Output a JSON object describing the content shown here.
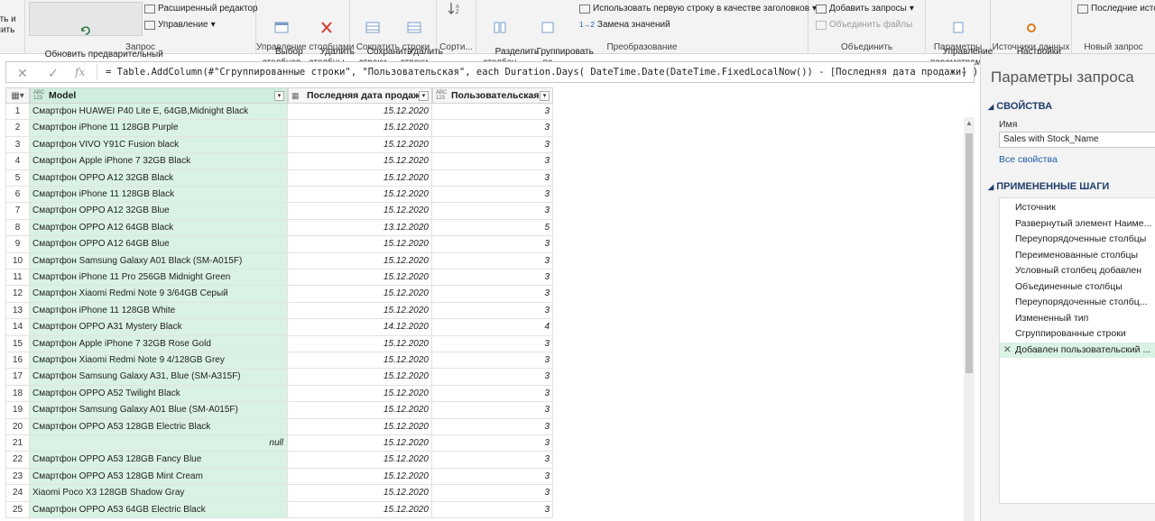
{
  "ribbon": {
    "cut_btn": "ить и\nнить",
    "group_query": {
      "refresh": "Обновить предварительный\nпросмотр",
      "advanced_editor": "Расширенный редактор",
      "manage": "Управление",
      "label": "Запрос"
    },
    "group_columns": {
      "choose": "Выбор\nстолбцов",
      "remove": "Удалить\nстолбцы",
      "label": "Управление столбцами"
    },
    "group_rows": {
      "keep": "Сохранить\nстроки",
      "remove": "Удалить\nстроки",
      "label": "Сократить строки"
    },
    "group_sort": {
      "label": "Сорти..."
    },
    "group_transform": {
      "split": "Разделить\nстолбец",
      "group_by": "Группировать\nпо",
      "use_first_row": "Использовать первую строку в качестве заголовков",
      "replace": "Замена значений",
      "label": "Преобразование"
    },
    "group_combine": {
      "append": "Добавить запросы",
      "merge_files": "Объединить файлы",
      "label": "Объединить"
    },
    "group_params": {
      "manage": "Управление\nпараметрами",
      "label": "Параметры"
    },
    "group_sources": {
      "settings": "Настройки\nисточника данных",
      "label": "Источники данных"
    },
    "group_new": {
      "recent": "Последние исто",
      "label": "Новый запрос"
    }
  },
  "formula_bar": {
    "formula": "= Table.AddColumn(#\"Сгруппированные строки\", \"Пользовательская\", each Duration.Days( DateTime.Date(DateTime.FixedLocalNow())  - [Последняя дата продажи] ))"
  },
  "table": {
    "columns": [
      {
        "type": "ABC\n123",
        "name": "Model"
      },
      {
        "type": "date",
        "name": "Последняя дата продажи"
      },
      {
        "type": "ABC\n123",
        "name": "Пользовательская"
      }
    ],
    "rows": [
      {
        "n": "1",
        "model": "Смартфон HUAWEI P40 Lite E, 64GB,Midnight Black",
        "date": "15.12.2020",
        "val": "3"
      },
      {
        "n": "2",
        "model": "Смартфон iPhone 11 128GB Purple",
        "date": "15.12.2020",
        "val": "3"
      },
      {
        "n": "3",
        "model": "Смартфон VIVO Y91C Fusion black",
        "date": "15.12.2020",
        "val": "3"
      },
      {
        "n": "4",
        "model": "Смартфон Apple iPhone 7 32GB Black",
        "date": "15.12.2020",
        "val": "3"
      },
      {
        "n": "5",
        "model": "Смартфон OPPO A12 32GB Black",
        "date": "15.12.2020",
        "val": "3"
      },
      {
        "n": "6",
        "model": "Смартфон iPhone 11 128GB Black",
        "date": "15.12.2020",
        "val": "3"
      },
      {
        "n": "7",
        "model": "Смартфон OPPO A12 32GB Blue",
        "date": "15.12.2020",
        "val": "3"
      },
      {
        "n": "8",
        "model": "Смартфон OPPO A12 64GB Black",
        "date": "13.12.2020",
        "val": "5"
      },
      {
        "n": "9",
        "model": "Смартфон OPPO A12 64GB Blue",
        "date": "15.12.2020",
        "val": "3"
      },
      {
        "n": "10",
        "model": "Смартфон Samsung Galaxy A01 Black (SM-A015F)",
        "date": "15.12.2020",
        "val": "3"
      },
      {
        "n": "11",
        "model": "Смартфон iPhone 11 Pro 256GB Midnight Green",
        "date": "15.12.2020",
        "val": "3"
      },
      {
        "n": "12",
        "model": "Смартфон Xiaomi Redmi Note 9 3/64GB Серый",
        "date": "15.12.2020",
        "val": "3"
      },
      {
        "n": "13",
        "model": "Смартфон iPhone 11 128GB White",
        "date": "15.12.2020",
        "val": "3"
      },
      {
        "n": "14",
        "model": "Смартфон OPPO A31 Mystery Black",
        "date": "14.12.2020",
        "val": "4"
      },
      {
        "n": "15",
        "model": "Смартфон Apple iPhone 7 32GB Rose Gold",
        "date": "15.12.2020",
        "val": "3"
      },
      {
        "n": "16",
        "model": "Смартфон Xiaomi Redmi Note 9 4/128GB Grey",
        "date": "15.12.2020",
        "val": "3"
      },
      {
        "n": "17",
        "model": "Смартфон Samsung Galaxy A31, Blue (SM-A315F)",
        "date": "15.12.2020",
        "val": "3"
      },
      {
        "n": "18",
        "model": "Смартфон OPPO A52 Twilight Black",
        "date": "15.12.2020",
        "val": "3"
      },
      {
        "n": "19",
        "model": "Смартфон Samsung Galaxy A01 Blue (SM-A015F)",
        "date": "15.12.2020",
        "val": "3"
      },
      {
        "n": "20",
        "model": "Смартфон OPPO A53 128GB Electric Black",
        "date": "15.12.2020",
        "val": "3"
      },
      {
        "n": "21",
        "model": "null",
        "date": "15.12.2020",
        "val": "3"
      },
      {
        "n": "22",
        "model": "Смартфон OPPO A53 128GB Fancy Blue",
        "date": "15.12.2020",
        "val": "3"
      },
      {
        "n": "23",
        "model": "Смартфон OPPO A53 128GB Mint Cream",
        "date": "15.12.2020",
        "val": "3"
      },
      {
        "n": "24",
        "model": "Xiaomi Poco X3 128GB Shadow Gray",
        "date": "15.12.2020",
        "val": "3"
      },
      {
        "n": "25",
        "model": "Смартфон OPPO A53 64GB Electric Black",
        "date": "15.12.2020",
        "val": "3"
      }
    ]
  },
  "pane": {
    "title": "Параметры запроса",
    "properties_title": "СВОЙСТВА",
    "name_label": "Имя",
    "name_value": "Sales with Stock_Name",
    "all_properties": "Все свойства",
    "steps_title": "ПРИМЕНЕННЫЕ ШАГИ",
    "steps": [
      "Источник",
      "Развернутый элемент Наиме...",
      "Переупорядоченные столбцы",
      "Переименованные столбцы",
      "Условный столбец добавлен",
      "Объединенные столбцы",
      "Переупорядоченные столбц...",
      "Измененный тип",
      "Сгруппированные строки",
      "Добавлен пользовательский ..."
    ]
  },
  "colors": {
    "accent": "#1f3d6b",
    "selected_column": "#d9f2e3",
    "link": "#1e5aa8"
  }
}
